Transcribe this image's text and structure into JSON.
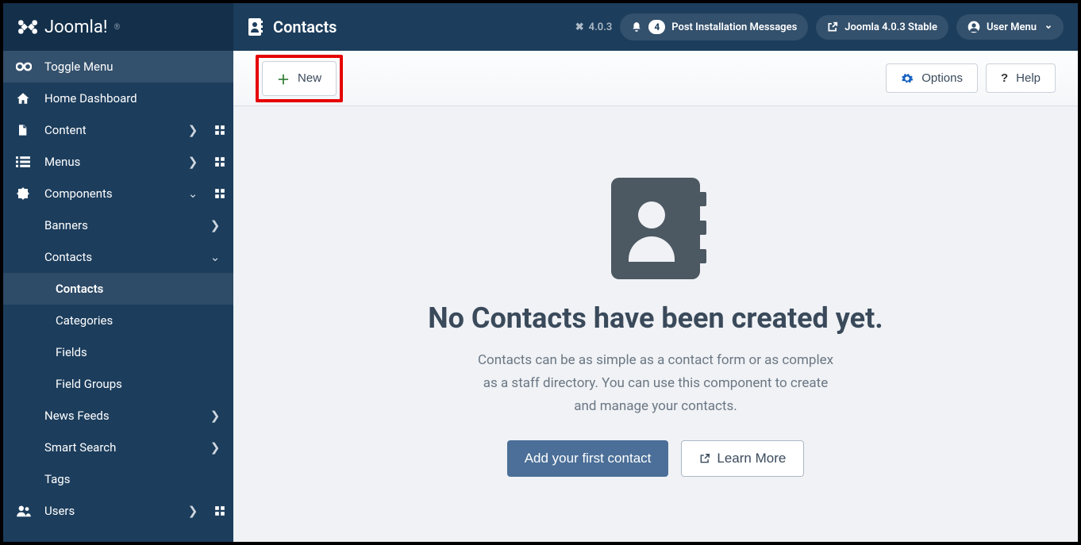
{
  "brand": {
    "name": "Joomla!",
    "trademark": "®"
  },
  "header": {
    "title": "Contacts",
    "version_short": "4.0.3",
    "notifications_count": "4",
    "post_install_label": "Post Installation Messages",
    "version_long": "Joomla 4.0.3 Stable",
    "user_menu_label": "User Menu"
  },
  "sidebar": {
    "toggle_label": "Toggle Menu",
    "items": [
      {
        "label": "Home Dashboard"
      },
      {
        "label": "Content"
      },
      {
        "label": "Menus"
      },
      {
        "label": "Components"
      },
      {
        "label": "Users"
      }
    ],
    "components": [
      {
        "label": "Banners"
      },
      {
        "label": "Contacts"
      },
      {
        "label": "News Feeds"
      },
      {
        "label": "Smart Search"
      },
      {
        "label": "Tags"
      }
    ],
    "contacts_sub": [
      {
        "label": "Contacts"
      },
      {
        "label": "Categories"
      },
      {
        "label": "Fields"
      },
      {
        "label": "Field Groups"
      }
    ]
  },
  "toolbar": {
    "new_label": "New",
    "options_label": "Options",
    "help_label": "Help"
  },
  "empty": {
    "title": "No Contacts have been created yet.",
    "desc": "Contacts can be as simple as a contact form or as complex as a staff directory. You can use this component to create and manage your contacts.",
    "primary": "Add your first contact",
    "secondary": "Learn More"
  }
}
